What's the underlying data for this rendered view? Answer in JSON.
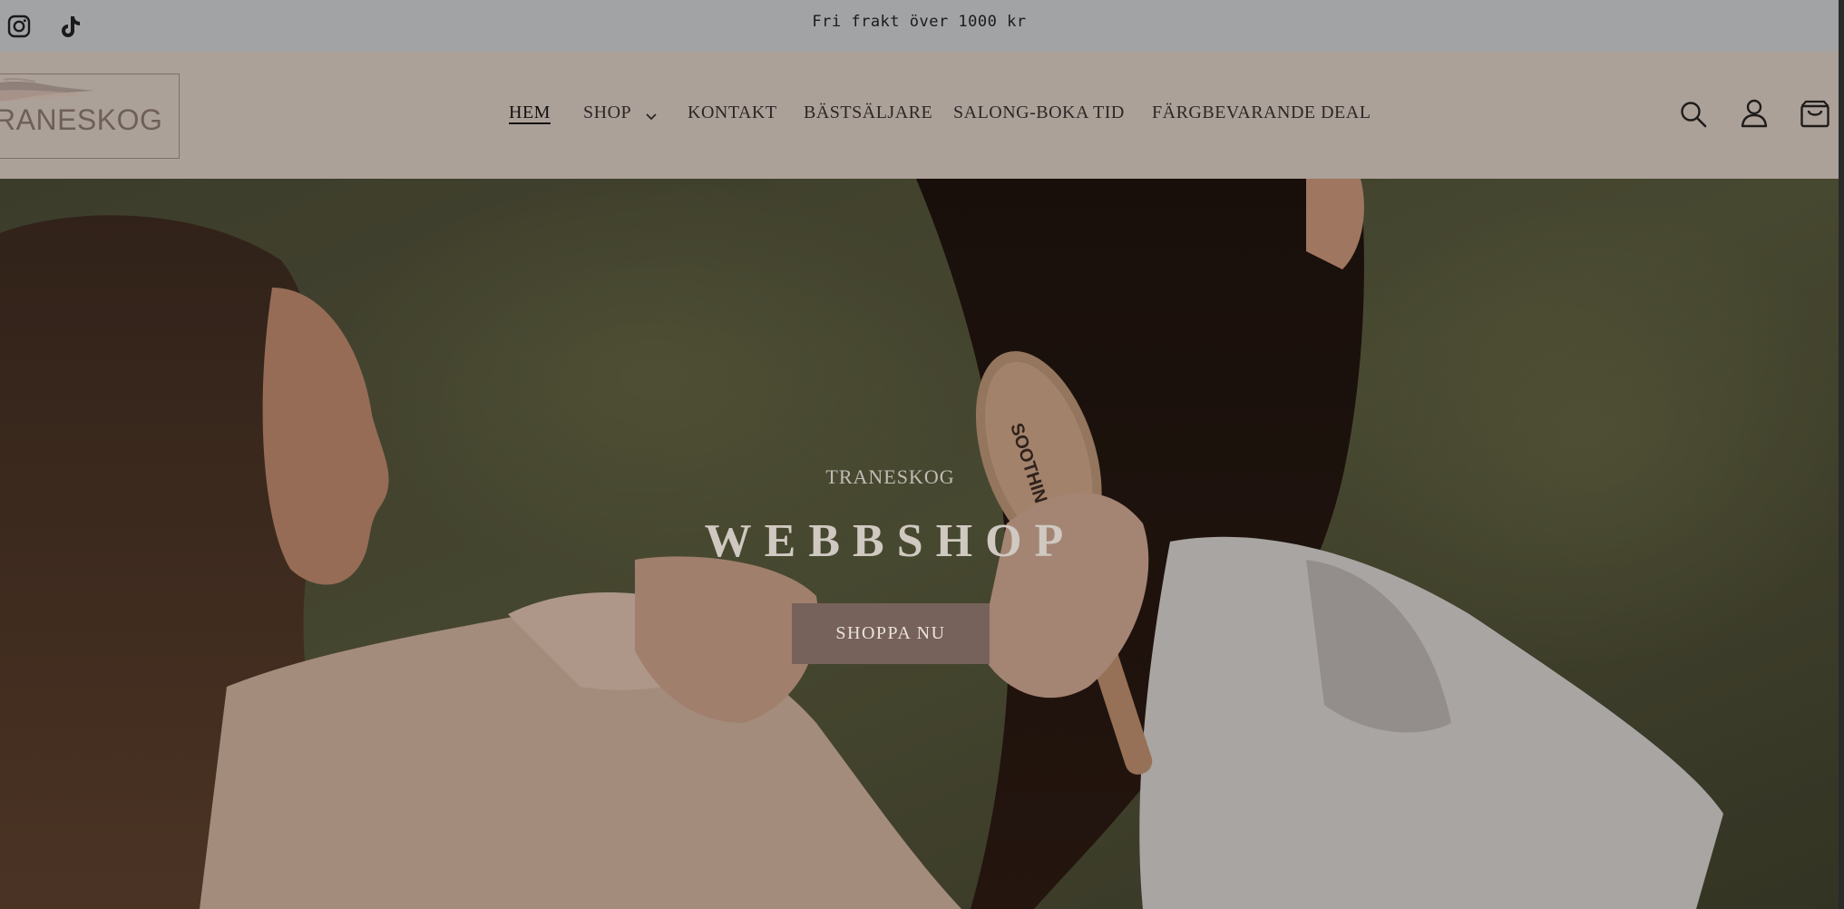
{
  "topbar": {
    "announcement": "Fri frakt över 1000 kr",
    "social": [
      {
        "icon": "instagram-icon"
      },
      {
        "icon": "tiktok-icon"
      }
    ]
  },
  "header": {
    "logo_text": "RANESKOG",
    "nav": [
      {
        "label": "HEM",
        "active": true
      },
      {
        "label": "SHOP",
        "has_dropdown": true
      },
      {
        "label": "KONTAKT"
      },
      {
        "label": "BÄSTSÄLJARE"
      },
      {
        "label": "SALONG-BOKA TID"
      },
      {
        "label": "FÄRGBEVARANDE DEAL"
      }
    ],
    "icons": [
      "search-icon",
      "account-icon",
      "cart-icon"
    ]
  },
  "hero": {
    "eyebrow": "TRANESKOG",
    "title": "WEBBSHOP",
    "cta_label": "SHOPPA NU",
    "brush_text": "SOOTHING BAD"
  },
  "colors": {
    "topbar_bg": "#a2a3a4",
    "header_bg": "#aca199",
    "cta_bg": "#77625b",
    "logo_color": "#6e5f58"
  }
}
